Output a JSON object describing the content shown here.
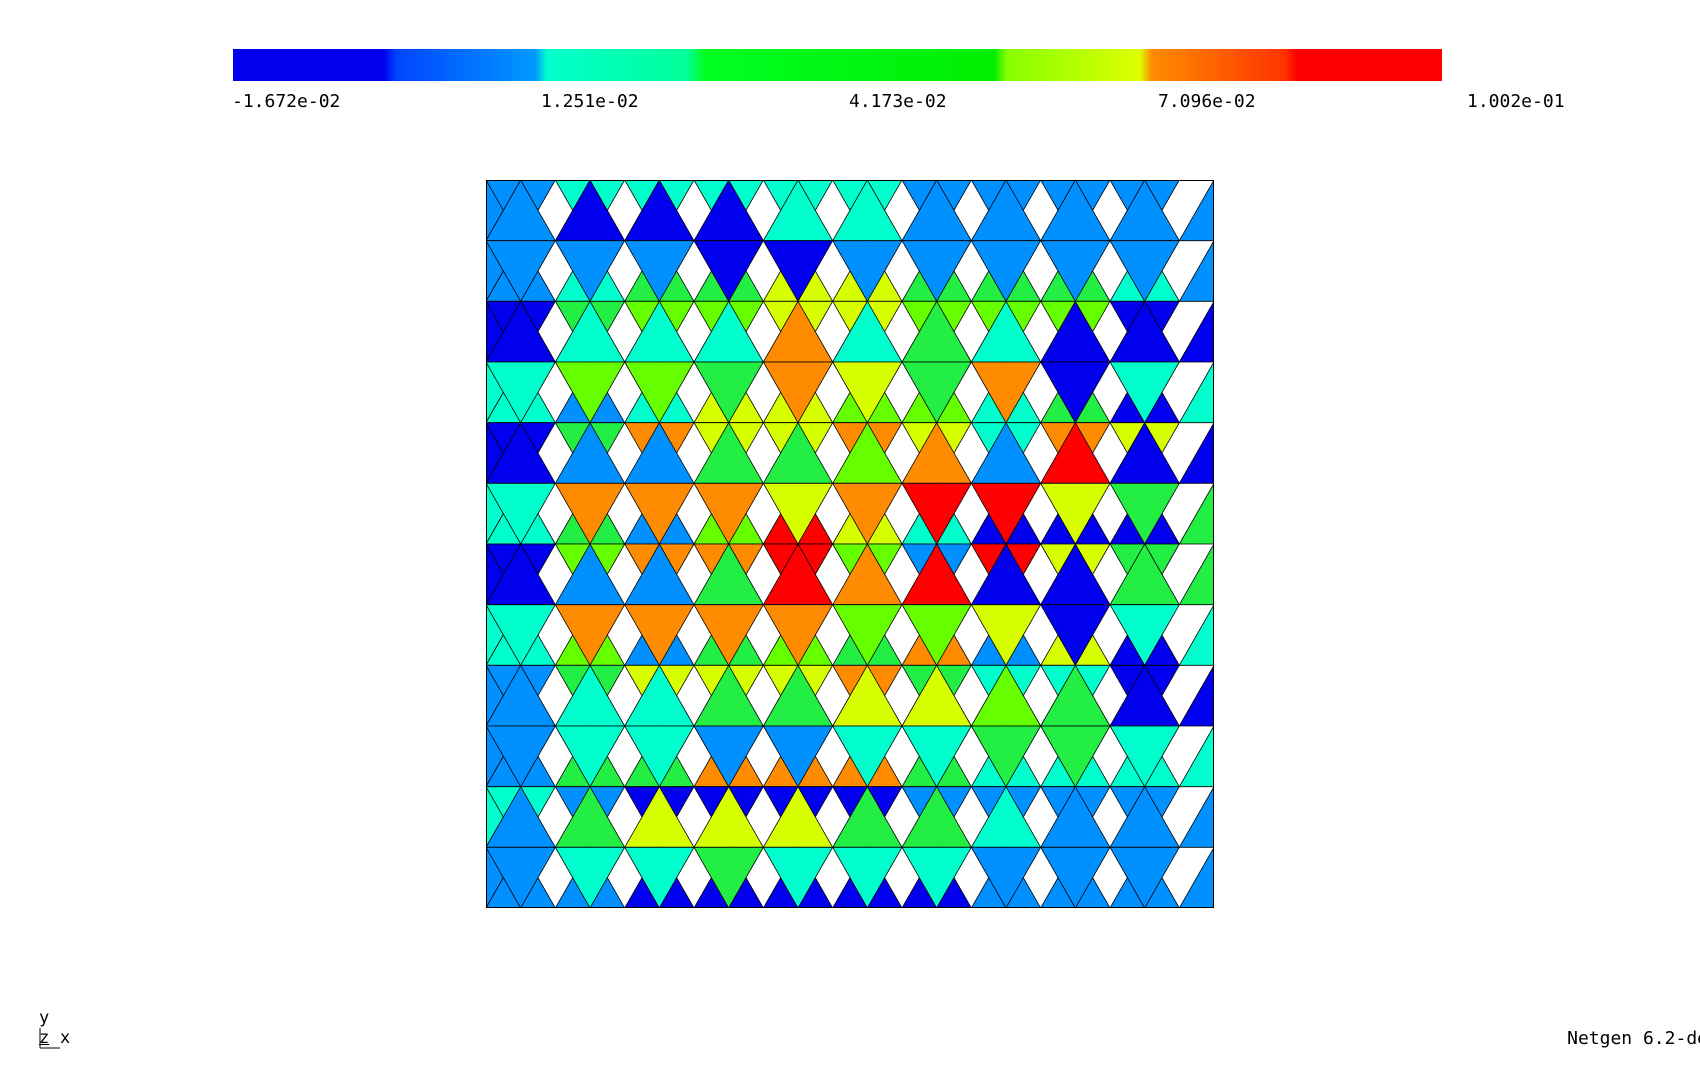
{
  "colorbar": {
    "labels": [
      "-1.672e-02",
      "1.251e-02",
      "4.173e-02",
      "7.096e-02",
      "1.002e-01"
    ],
    "stops": [
      "#0000ee",
      "#0055ff",
      "#00ffcc",
      "#00ff22",
      "#00ff00",
      "#aaff00",
      "#ff8800",
      "#ff0000"
    ]
  },
  "axes": {
    "y": "y",
    "z": "z",
    "x": "x"
  },
  "footer": {
    "version": "Netgen 6.2-de"
  },
  "mesh": {
    "colors": {
      "1": "#0000ee",
      "2": "#0090ff",
      "3": "#00ffcc",
      "4": "#22ee44",
      "5": "#66ff00",
      "6": "#d8ff00",
      "7": "#ff8c00",
      "8": "#ff0000"
    },
    "values": [
      [
        2,
        2,
        3,
        1,
        3,
        1,
        3,
        1,
        3,
        3,
        3,
        3,
        2,
        2,
        2,
        2,
        2,
        2,
        2,
        2
      ],
      [
        2,
        2,
        3,
        2,
        4,
        2,
        4,
        1,
        6,
        1,
        6,
        2,
        4,
        2,
        4,
        2,
        4,
        2,
        3,
        2
      ],
      [
        1,
        1,
        4,
        3,
        5,
        3,
        5,
        3,
        6,
        7,
        6,
        3,
        5,
        4,
        5,
        3,
        5,
        1,
        1,
        1
      ],
      [
        3,
        3,
        2,
        5,
        3,
        5,
        6,
        4,
        6,
        7,
        5,
        6,
        5,
        4,
        3,
        7,
        4,
        1,
        1,
        3
      ],
      [
        1,
        1,
        4,
        2,
        7,
        2,
        6,
        4,
        6,
        4,
        7,
        5,
        6,
        7,
        3,
        2,
        7,
        8,
        6,
        1
      ],
      [
        3,
        3,
        4,
        7,
        2,
        7,
        5,
        7,
        8,
        6,
        6,
        7,
        3,
        8,
        1,
        8,
        1,
        6,
        1,
        4
      ],
      [
        1,
        1,
        5,
        2,
        7,
        2,
        7,
        4,
        8,
        8,
        5,
        7,
        2,
        8,
        8,
        1,
        6,
        1,
        4,
        4
      ],
      [
        3,
        3,
        5,
        7,
        2,
        7,
        4,
        7,
        5,
        7,
        4,
        5,
        7,
        5,
        2,
        6,
        6,
        1,
        1,
        3
      ],
      [
        2,
        2,
        4,
        3,
        6,
        3,
        6,
        4,
        6,
        4,
        7,
        6,
        4,
        6,
        3,
        5,
        3,
        4,
        1,
        1
      ],
      [
        2,
        2,
        4,
        3,
        4,
        3,
        7,
        2,
        7,
        2,
        7,
        3,
        4,
        3,
        3,
        4,
        3,
        4,
        3,
        3
      ],
      [
        3,
        2,
        2,
        4,
        1,
        6,
        1,
        6,
        1,
        6,
        1,
        4,
        2,
        4,
        2,
        3,
        2,
        2,
        2,
        2
      ],
      [
        2,
        2,
        2,
        3,
        1,
        3,
        1,
        4,
        1,
        3,
        1,
        3,
        1,
        3,
        2,
        2,
        2,
        2,
        2,
        2
      ]
    ]
  }
}
